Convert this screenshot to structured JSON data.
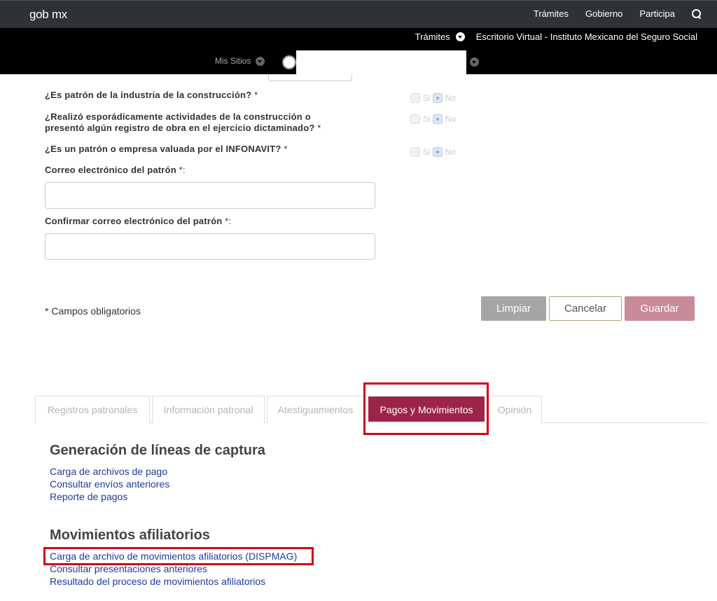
{
  "header": {
    "logo": "gob mx",
    "nav": [
      "Trámites",
      "Gobierno",
      "Participa"
    ],
    "tramites_label": "Trámites",
    "site_title": "Escritorio Virtual - Instituto Mexicano del Seguro Social",
    "mis_sitios": "Mis Sitios"
  },
  "form": {
    "q1": "¿Es patrón de la industria de la construcción?",
    "q2a": "¿Realizó esporádicamente actividades de la construcción o",
    "q2b": "presentó algún registro de obra en el ejercicio dictaminado?",
    "q3": "¿Es un patrón o empresa valuada por el INFONAVIT?",
    "email_label": "Correo electrónico del patrón",
    "confirm_label": "Confirmar correo electrónico del patrón",
    "required_mark": "*",
    "colon": ":",
    "yes": "Si",
    "no": "No",
    "selected": "No",
    "email_value": "",
    "confirm_value": "",
    "required_note": "* Campos obligatorios",
    "btn_clear": "Limpiar",
    "btn_cancel": "Cancelar",
    "btn_save": "Guardar"
  },
  "tabs": [
    "Registros patronales",
    "Información patronal",
    "Atestiguamientos",
    "Pagos y Movimientos",
    "Opinión"
  ],
  "active_tab": "Pagos y Movimientos",
  "section1": {
    "title": "Generación de líneas de captura",
    "links": [
      "Carga de archivos de pago",
      "Consultar envíos anteriores",
      "Reporte de pagos"
    ]
  },
  "section2": {
    "title": "Movimientos afiliatorios",
    "links": [
      "Carga de archivo de movimientos afiliatorios (DISPMAG)",
      "Consultar presentaciones anteriores",
      "Resultado del proceso de movimientos afiliatorios"
    ]
  },
  "colors": {
    "accent": "#9d2449",
    "highlight": "#d0021b",
    "link": "#1f3d99"
  }
}
